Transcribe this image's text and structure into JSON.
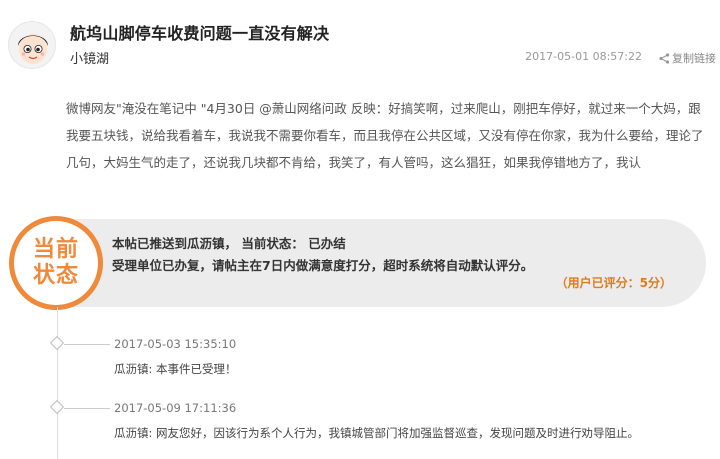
{
  "post": {
    "title": "航坞山脚停车收费问题一直没有解决",
    "author": "小镜湖",
    "time": "2017-05-01 08:57:22",
    "copy_label": "复制链接",
    "content": "微博网友\"淹没在笔记中 \"4月30日 @萧山网络问政 反映：好搞笑啊，过来爬山，刚把车停好，就过来一个大妈，跟我要五块钱，说给我看着车，我说我不需要你看车，而且我停在公共区域，又没有停在你家，我为什么要给，理论了几句，大妈生气的走了，还说我几块都不肯给，我笑了，有人管吗，这么猖狂，如果我停错地方了，我认"
  },
  "status": {
    "badge_line1": "当前",
    "badge_line2": "状态",
    "line1": "本帖已推送到瓜沥镇， 当前状态： 已办结",
    "line2": "受理单位已办复，请帖主在7日内做满意度打分，超时系统将自动默认评分。",
    "rating": "（用户已评分：5分）",
    "accent_color": "#f0893a"
  },
  "timeline": [
    {
      "time": "2017-05-03 15:35:10",
      "text": "瓜沥镇: 本事件已受理！"
    },
    {
      "time": "2017-05-09 17:11:36",
      "text": "瓜沥镇: 网友您好，因该行为系个人行为，我镇城管部门将加强监督巡查，发现问题及时进行劝导阻止。"
    }
  ],
  "icons": {
    "avatar": "cartoon-avatar",
    "copy": "share-icon"
  }
}
